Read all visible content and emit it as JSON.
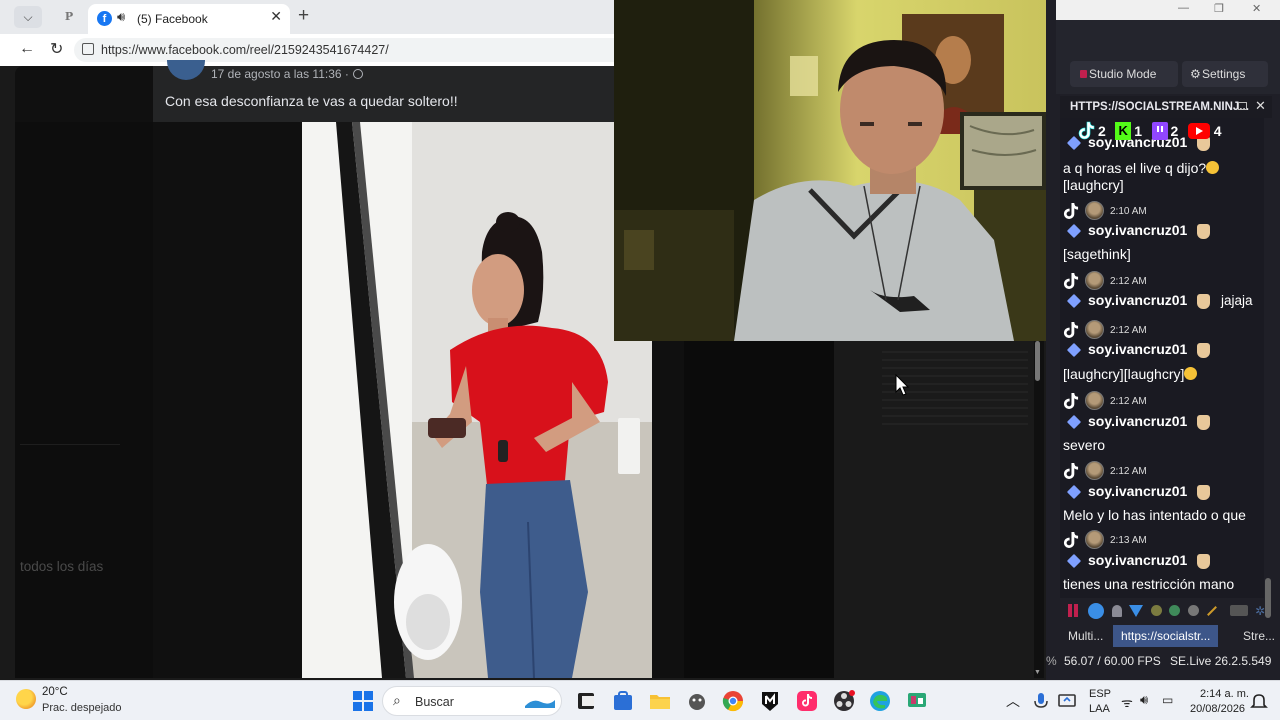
{
  "browser": {
    "tab_title": "(5) Facebook",
    "pinned_tab_letter": "P",
    "url": "https://www.facebook.com/reel/2159243541674427/"
  },
  "post": {
    "date": "17 de agosto a las 11:36 ·",
    "caption": "Con esa desconfianza te vas a quedar soltero!!",
    "side_label": "todos los días"
  },
  "studio": {
    "studio_mode_label": "Studio Mode",
    "settings_label": "Settings",
    "dock_title": "HTTPS://SOCIALSTREAM.NINJ...",
    "counts": {
      "tiktok": "2",
      "kick": "1",
      "twitch": "2",
      "youtube": "4"
    },
    "messages": [
      {
        "time": "",
        "user": "soy.ivancruz01",
        "inline": "",
        "text": "a q horas el live q dijo?",
        "text2": "[laughcry]"
      },
      {
        "time": "2:10 AM",
        "user": "soy.ivancruz01",
        "inline": "",
        "text": "[sagethink]",
        "text2": ""
      },
      {
        "time": "2:12 AM",
        "user": "soy.ivancruz01",
        "inline": "jajaja",
        "text": "",
        "text2": ""
      },
      {
        "time": "2:12 AM",
        "user": "soy.ivancruz01",
        "inline": "",
        "text": "[laughcry][laughcry]",
        "text2": ""
      },
      {
        "time": "2:12 AM",
        "user": "soy.ivancruz01",
        "inline": "",
        "text": "severo",
        "text2": ""
      },
      {
        "time": "2:12 AM",
        "user": "soy.ivancruz01",
        "inline": "",
        "text": "Melo y lo has intentado o que",
        "text2": ""
      },
      {
        "time": "2:13 AM",
        "user": "soy.ivancruz01",
        "inline": "",
        "text": "tienes una restricción mano",
        "text2": ""
      }
    ],
    "bottom_tabs": [
      "Multi...",
      "https://socialstr...",
      "Stre..."
    ],
    "fps": "56.07 / 60.00 FPS",
    "version": "SE.Live 26.2.5.549",
    "edge_char": "%"
  },
  "taskbar": {
    "temperature": "20°C",
    "condition": "Prac. despejado",
    "search_placeholder": "Buscar",
    "lang": "ESP",
    "region": "LAA",
    "time": "2:14 a. m.",
    "date": "20/08/2026"
  }
}
